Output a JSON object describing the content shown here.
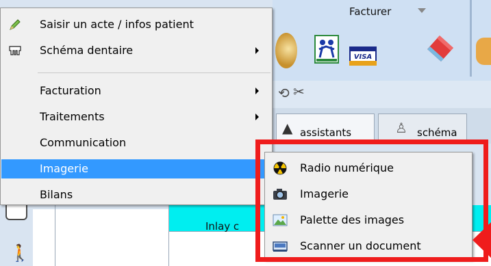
{
  "toolbar": {
    "facturer_label": "Facturer",
    "visa_label": "VISA"
  },
  "tabs": [
    {
      "label": "assistants",
      "icon": "wizard-hat-icon"
    },
    {
      "label": "schéma",
      "icon": "tooth-icon"
    }
  ],
  "grid": {
    "cell_text": "Inlay c"
  },
  "context_menu": {
    "items": [
      {
        "label": "Saisir un acte / infos patient",
        "icon": "pencil-icon",
        "submenu": false
      },
      {
        "label": "Schéma dentaire",
        "icon": "teeth-icon",
        "submenu": true
      },
      {
        "label": "Facturation",
        "submenu": true
      },
      {
        "label": "Traitements",
        "submenu": true
      },
      {
        "label": "Communication",
        "submenu": true
      },
      {
        "label": "Imagerie",
        "submenu": true,
        "selected": true
      },
      {
        "label": "Bilans",
        "submenu": false
      }
    ]
  },
  "submenu": {
    "items": [
      {
        "label": "Radio numérique",
        "icon": "radiation-icon"
      },
      {
        "label": "Imagerie",
        "icon": "camera-icon"
      },
      {
        "label": "Palette des images",
        "icon": "image-palette-icon"
      },
      {
        "label": "Scanner un document",
        "icon": "scanner-icon"
      }
    ]
  },
  "colors": {
    "highlight": "#3399ff",
    "annotation": "#ef1c1c",
    "cyan_cell": "#00eef0"
  }
}
